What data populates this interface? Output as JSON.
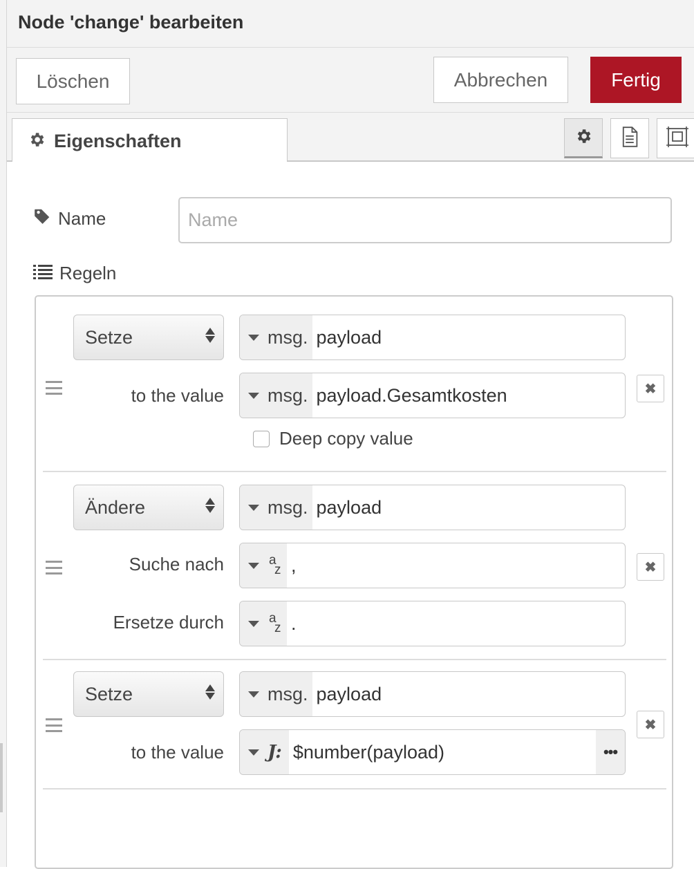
{
  "header": {
    "title": "Node 'change' bearbeiten"
  },
  "toolbar": {
    "delete_label": "Löschen",
    "cancel_label": "Abbrechen",
    "done_label": "Fertig"
  },
  "tabs": {
    "properties_label": "Eigenschaften",
    "icons": [
      "gear-icon",
      "document-icon",
      "frame-icon"
    ]
  },
  "form": {
    "name_label": "Name",
    "name_placeholder": "Name",
    "name_value": "",
    "rules_label": "Regeln"
  },
  "rules": [
    {
      "action": "Setze",
      "target_prefix": "msg.",
      "target_value": "payload",
      "value_label": "to the value",
      "value_prefix": "msg.",
      "value_value": "payload.Gesamtkosten",
      "deep_copy_label": "Deep copy value"
    },
    {
      "action": "Ändere",
      "target_prefix": "msg.",
      "target_value": "payload",
      "search_label": "Suche nach",
      "search_type_a": "a",
      "search_type_z": "z",
      "search_value": ",",
      "replace_label": "Ersetze durch",
      "replace_type_a": "a",
      "replace_type_z": "z",
      "replace_value": "."
    },
    {
      "action": "Setze",
      "target_prefix": "msg.",
      "target_value": "payload",
      "value_label": "to the value",
      "value_type_symbol": "J:",
      "value_value": "$number(payload)",
      "more_label": "•••"
    }
  ],
  "colors": {
    "primary": "#ad1625",
    "panel": "#f3f3f3",
    "border": "#c8c8c8"
  }
}
